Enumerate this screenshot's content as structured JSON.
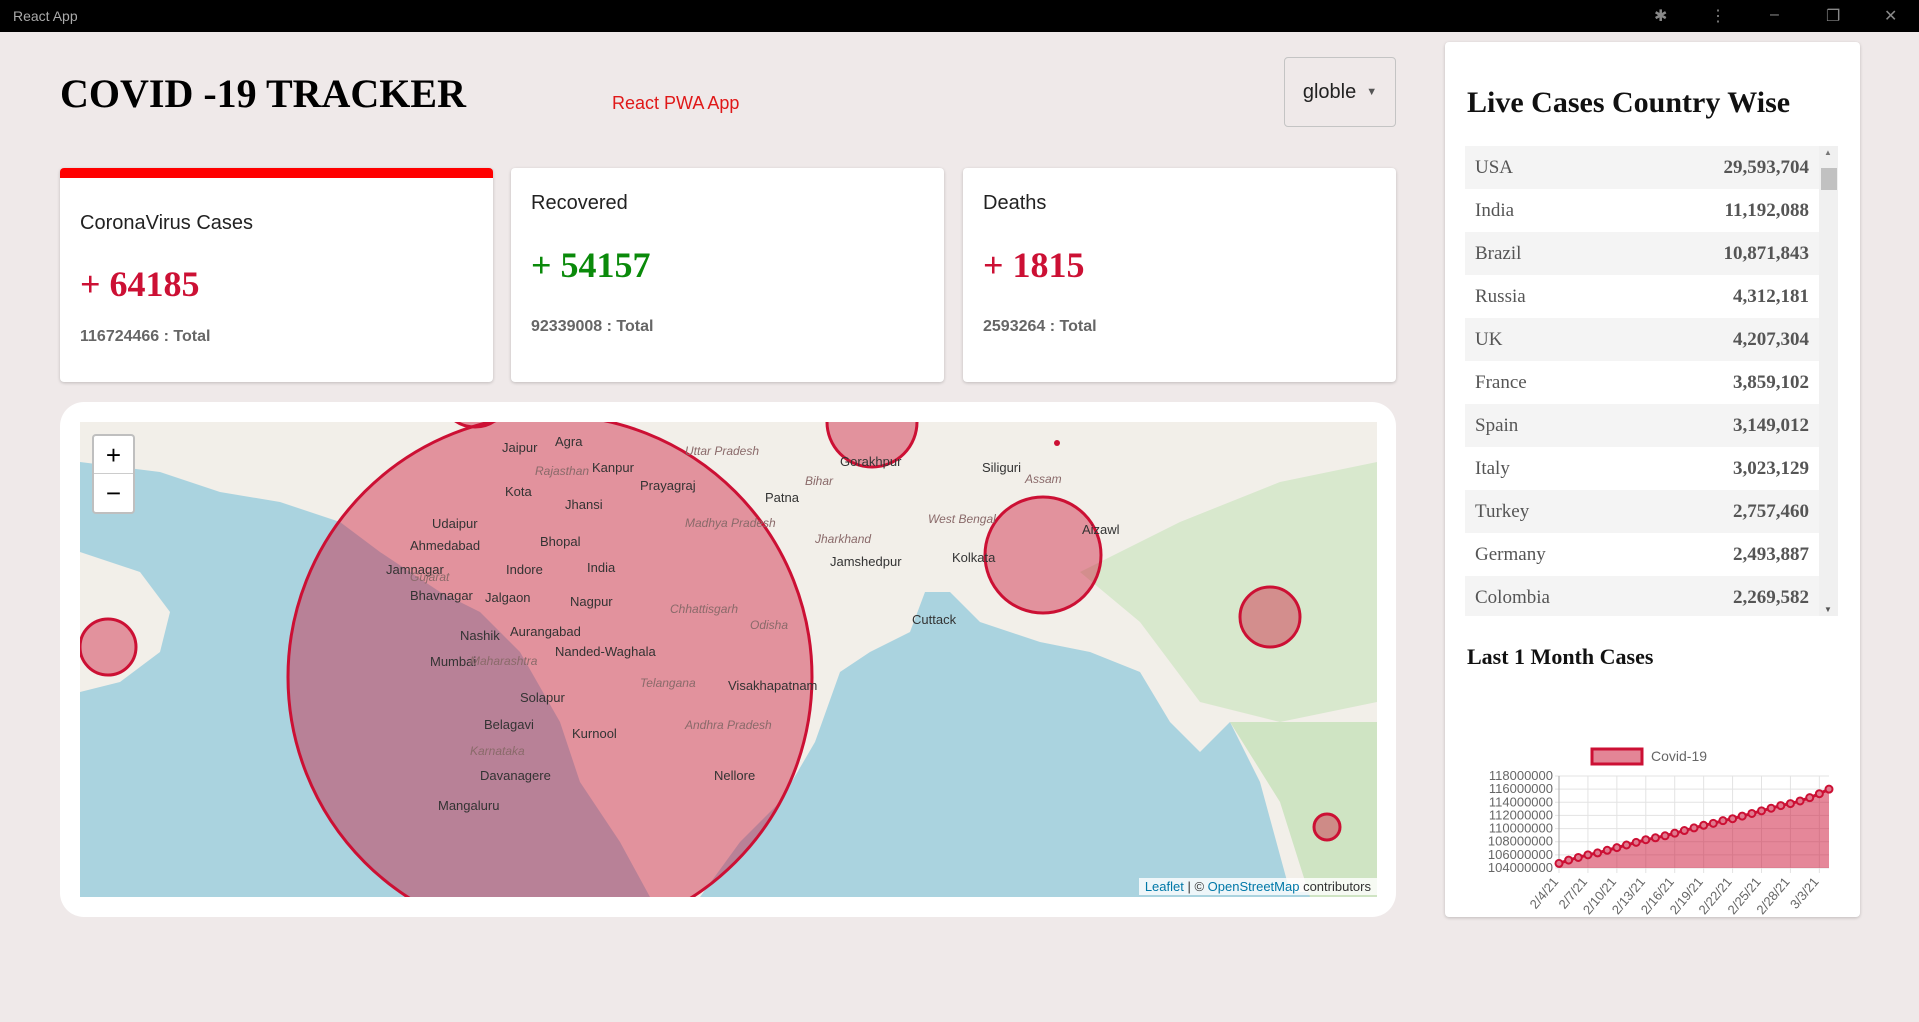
{
  "window": {
    "title": "React App",
    "icons": [
      "puzzle-icon",
      "kebab-menu-icon",
      "minimize-icon",
      "restore-icon",
      "close-icon"
    ]
  },
  "header": {
    "title": "COVID -19 TRACKER",
    "subtitle": "React PWA App",
    "dropdown_value": "globle"
  },
  "cards": [
    {
      "label": "CoronaVirus Cases",
      "value": "+ 64185",
      "total": "116724466 : Total",
      "color": "#cc1034",
      "active": true
    },
    {
      "label": "Recovered",
      "value": "+ 54157",
      "total": "92339008 : Total",
      "color": "#0a8a0a"
    },
    {
      "label": "Deaths",
      "value": "+ 1815",
      "total": "2593264 : Total",
      "color": "#cc1034"
    }
  ],
  "map": {
    "zoom_in": "+",
    "zoom_out": "−",
    "attribution_leaflet": "Leaflet",
    "attribution_sep": " | © ",
    "attribution_osm": "OpenStreetMap",
    "attribution_tail": " contributors",
    "labels": [
      "Jaipur",
      "Agra",
      "Kanpur",
      "Prayagraj",
      "Kota",
      "Jhansi",
      "Udaipur",
      "Ahmedabad",
      "Bhopal",
      "India",
      "Indore",
      "Jamnagar",
      "Bhavnagar",
      "Jalgaon",
      "Nagpur",
      "Nashik",
      "Aurangabad",
      "Mumbai",
      "Nanded-Waghala",
      "Visakhapatnam",
      "Solapur",
      "Belagavi",
      "Kurnool",
      "Davanagere",
      "Nellore",
      "Mangaluru",
      "Patna",
      "Siliguri",
      "Aizawl",
      "Kolkata",
      "Cuttack",
      "Gorakhpur",
      "Jamshedpur",
      "Rajasthan",
      "Gujarat",
      "Maharashtra",
      "Telangana",
      "Karnataka",
      "Chhattisgarh",
      "Odisha",
      "Bihar",
      "Madhya Pradesh",
      "Jharkhand",
      "West Bengal",
      "Assam",
      "Uttar Pradesh",
      "Andhra Pradesh"
    ],
    "circle_color": "#cc1034"
  },
  "countries": {
    "title": "Live Cases Country Wise",
    "rows": [
      {
        "name": "USA",
        "cases": "29,593,704"
      },
      {
        "name": "India",
        "cases": "11,192,088"
      },
      {
        "name": "Brazil",
        "cases": "10,871,843"
      },
      {
        "name": "Russia",
        "cases": "4,312,181"
      },
      {
        "name": "UK",
        "cases": "4,207,304"
      },
      {
        "name": "France",
        "cases": "3,859,102"
      },
      {
        "name": "Spain",
        "cases": "3,149,012"
      },
      {
        "name": "Italy",
        "cases": "3,023,129"
      },
      {
        "name": "Turkey",
        "cases": "2,757,460"
      },
      {
        "name": "Germany",
        "cases": "2,493,887"
      },
      {
        "name": "Colombia",
        "cases": "2,269,582"
      }
    ]
  },
  "chart_title": "Last 1 Month Cases",
  "chart_data": {
    "type": "area",
    "legend": "top",
    "grid": true,
    "series": [
      {
        "name": "Covid-19",
        "color": "#cc1034",
        "values": [
          104700000,
          105200000,
          105600000,
          106000000,
          106300000,
          106700000,
          107100000,
          107500000,
          107900000,
          108300000,
          108600000,
          108900000,
          109300000,
          109700000,
          110100000,
          110500000,
          110800000,
          111200000,
          111500000,
          111900000,
          112300000,
          112700000,
          113100000,
          113500000,
          113800000,
          114200000,
          114700000,
          115300000,
          116000000
        ]
      }
    ],
    "x_tick_labels": [
      "2/4/21",
      "2/7/21",
      "2/10/21",
      "2/13/21",
      "2/16/21",
      "2/19/21",
      "2/22/21",
      "2/25/21",
      "2/28/21",
      "3/3/21"
    ],
    "x_range": [
      "2/4/21",
      "3/4/21"
    ],
    "y_tick_labels": [
      "118000000",
      "116000000",
      "114000000",
      "112000000",
      "110000000",
      "108000000",
      "106000000",
      "104000000"
    ],
    "ylim": [
      104000000,
      118000000
    ]
  }
}
